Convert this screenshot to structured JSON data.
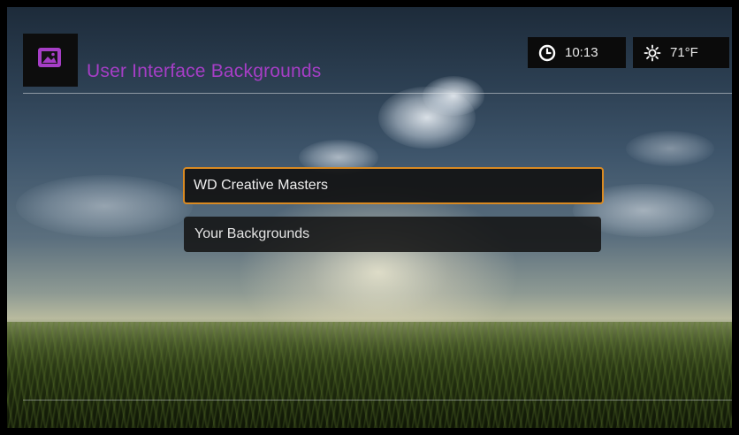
{
  "header": {
    "title": "User Interface Backgrounds",
    "app_icon": "picture-icon",
    "title_color": "#a63ec6"
  },
  "status": {
    "time": "10:13",
    "time_icon": "clock-icon",
    "temperature": "71°F",
    "weather_icon": "sun-icon"
  },
  "menu": {
    "items": [
      {
        "label": "WD Creative Masters",
        "selected": true
      },
      {
        "label": "Your Backgrounds",
        "selected": false
      }
    ],
    "highlight_color": "#d98a22"
  },
  "background": {
    "scene": "grass-field-sky"
  }
}
